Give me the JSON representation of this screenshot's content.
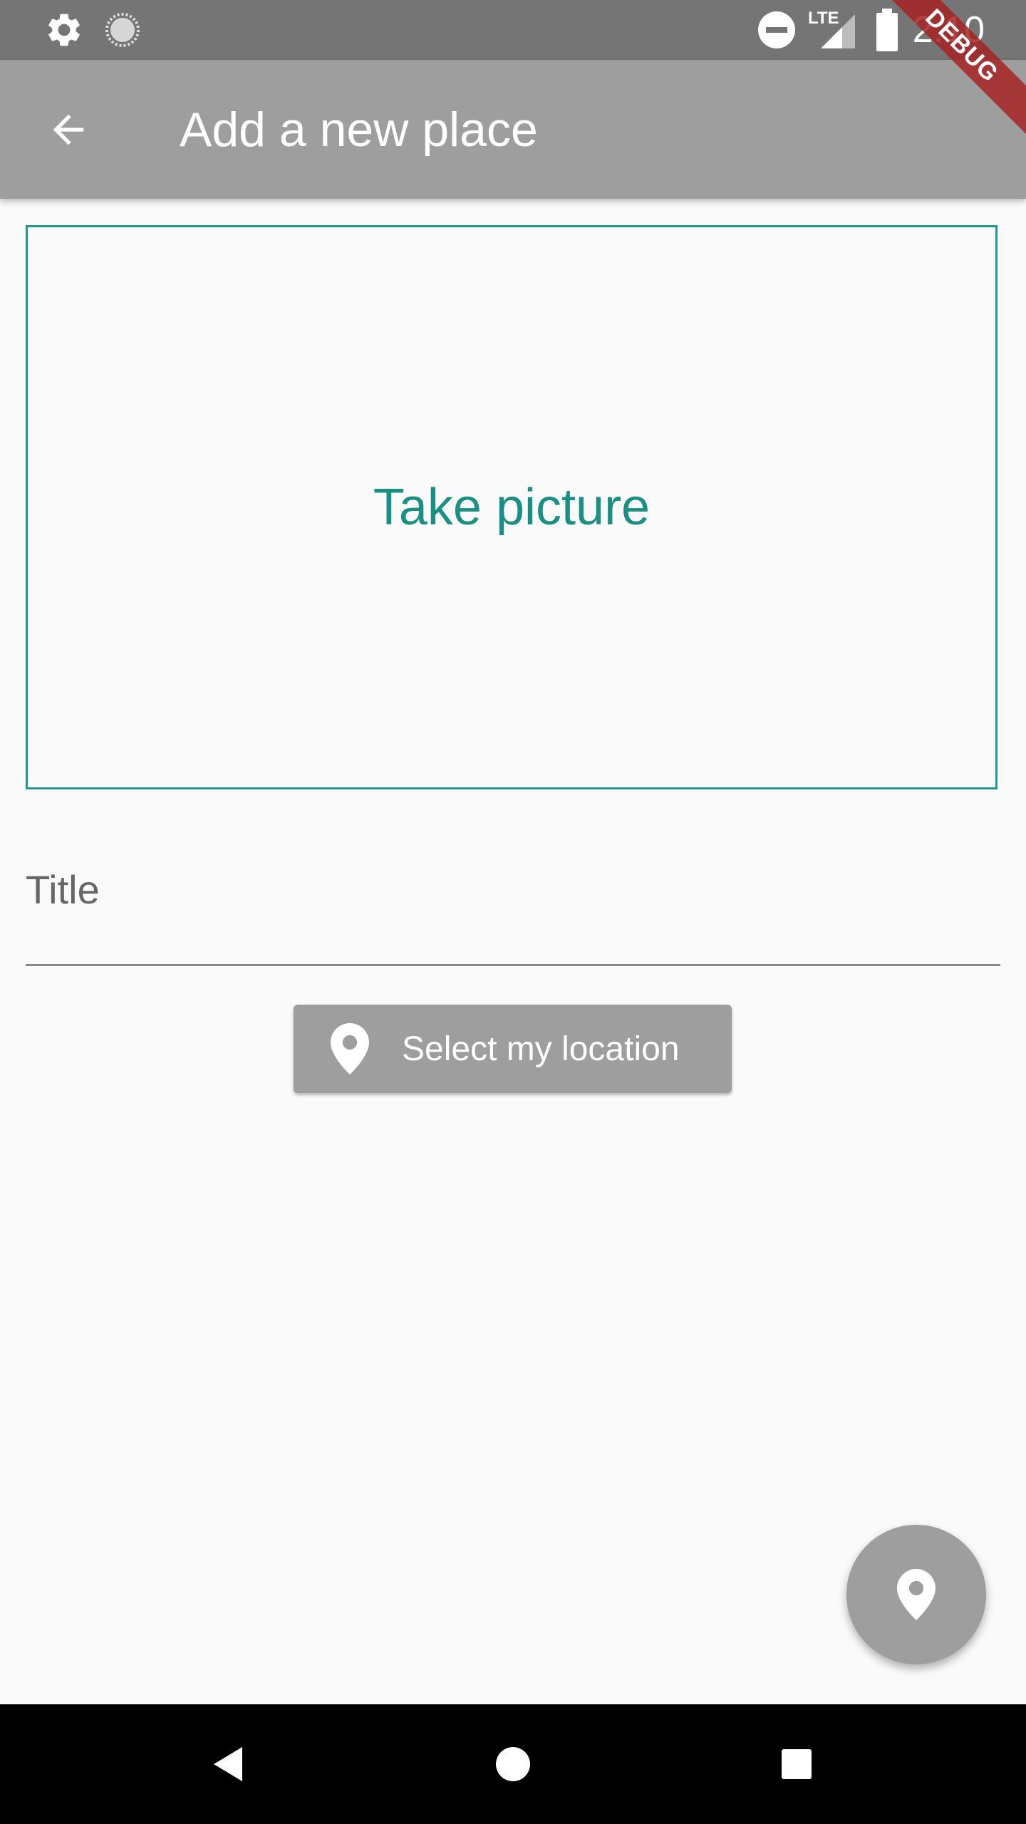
{
  "status_bar": {
    "time": "2:10",
    "network_label": "LTE",
    "icons": [
      "settings-icon",
      "loading-icon",
      "do-not-disturb-icon",
      "signal-icon",
      "battery-icon"
    ]
  },
  "app_bar": {
    "title": "Add a new place",
    "back_icon": "arrow-back-icon"
  },
  "debug_banner": {
    "label": "DEBUG"
  },
  "image_picker": {
    "label": "Take picture"
  },
  "title_field": {
    "placeholder": "Title",
    "value": ""
  },
  "location_button": {
    "label": "Select my location",
    "icon": "location-pin-icon"
  },
  "fab": {
    "icon": "location-pin-icon"
  },
  "navigation_bar": {
    "icons": [
      "back-triangle-icon",
      "home-circle-icon",
      "recents-square-icon"
    ]
  },
  "colors": {
    "status_bar": "#757575",
    "app_bar": "#9e9e9e",
    "accent": "#1a8f84",
    "background": "#fafafa",
    "button": "#9e9e9e"
  }
}
